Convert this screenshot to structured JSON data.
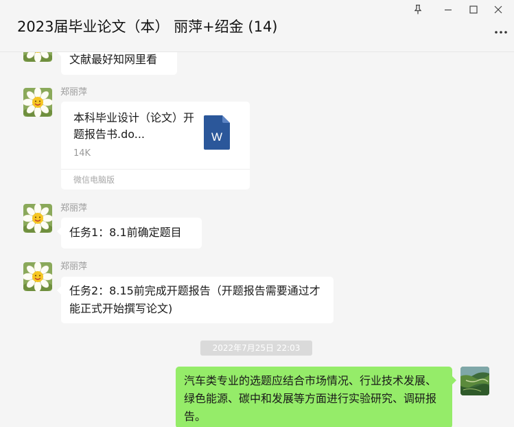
{
  "window": {
    "title": "2023届毕业论文（本） 丽萍+绍金 (14)",
    "controls": {
      "pin_icon": "pin-icon",
      "minimize_icon": "minimize-icon",
      "maximize_icon": "maximize-icon",
      "close_icon": "close-icon",
      "more_icon": "more-icon"
    }
  },
  "messages": [
    {
      "type": "text",
      "from": "other",
      "text": "文献最好知网里看"
    },
    {
      "type": "file",
      "from": "other",
      "sender": "郑丽萍",
      "file_name": "本科毕业设计（论文）开题报告书.do...",
      "file_size": "14K",
      "source": "微信电脑版",
      "file_icon_letter": "W"
    },
    {
      "type": "text",
      "from": "other",
      "sender": "郑丽萍",
      "text": "任务1：8.1前确定题目"
    },
    {
      "type": "text",
      "from": "other",
      "sender": "郑丽萍",
      "text": "任务2：8.15前完成开题报告（开题报告需要通过才能正式开始撰写论文)"
    },
    {
      "type": "timestamp",
      "text": "2022年7月25日 22:03"
    },
    {
      "type": "text",
      "from": "self",
      "text": "汽车类专业的选题应结合市场情况、行业技术发展、绿色能源、碳中和发展等方面进行实验研究、调研报告。"
    }
  ],
  "colors": {
    "background": "#f5f5f5",
    "bubble_other": "#ffffff",
    "bubble_self": "#95ec69",
    "word_icon": "#2b579a",
    "timestamp_bg": "#dadada"
  }
}
